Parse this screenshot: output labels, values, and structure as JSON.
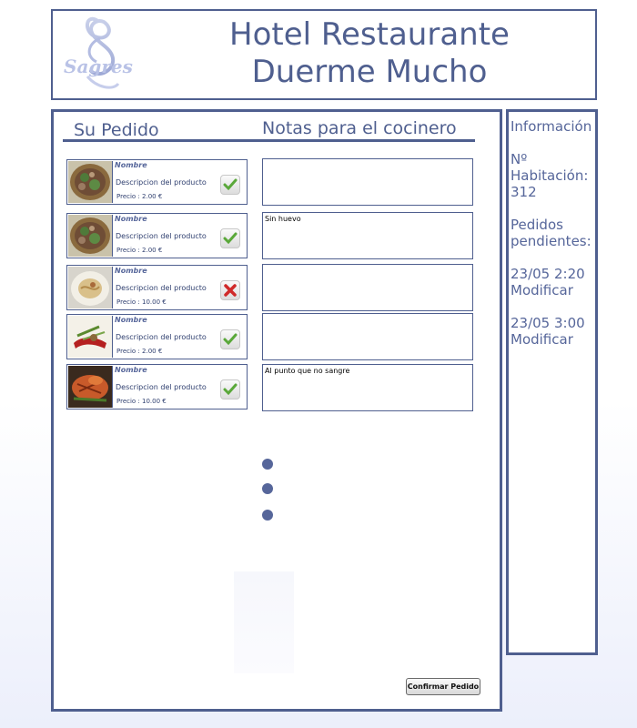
{
  "header": {
    "logo_text": "Sagres",
    "title_line1": "Hotel Restaurante",
    "title_line2": "Duerme Mucho"
  },
  "order": {
    "heading": "Su Pedido",
    "notes_heading": "Notas para el cocinero",
    "items": [
      {
        "name": "Nombre",
        "description": "Descripcion del producto",
        "price": "Precio :  2.00 €",
        "status": "check",
        "image": "salad",
        "note": ""
      },
      {
        "name": "Nombre",
        "description": "Descripcion del producto",
        "price": "Precio :  2.00 €",
        "status": "check",
        "image": "salad",
        "note": "Sin huevo"
      },
      {
        "name": "Nombre",
        "description": "Descripcion del producto",
        "price": "Precio :  10.00 €",
        "status": "cross",
        "image": "pasta",
        "note": ""
      },
      {
        "name": "Nombre",
        "description": "Descripcion del producto",
        "price": "Precio :  2.00 €",
        "status": "check",
        "image": "garnish",
        "note": ""
      },
      {
        "name": "Nombre",
        "description": "Descripcion del producto",
        "price": "Precio :  10.00 €",
        "status": "check",
        "image": "grilled",
        "note": "Al punto que no sangre"
      }
    ],
    "confirm_label": "Confirmar Pedido"
  },
  "sidebar": {
    "info_label": "Información",
    "room_label_1": "Nº",
    "room_label_2": "Habitación:",
    "room_number": "312",
    "pending_label_1": "Pedidos",
    "pending_label_2": "pendientes:",
    "pending": [
      {
        "time": "23/05 2:20",
        "action": "Modificar"
      },
      {
        "time": "23/05 3:00",
        "action": "Modificar"
      }
    ]
  },
  "colors": {
    "border": "#4f5f8f",
    "text": "#4a5a8a",
    "check": "#5aa83a",
    "cross": "#d02a2a"
  }
}
